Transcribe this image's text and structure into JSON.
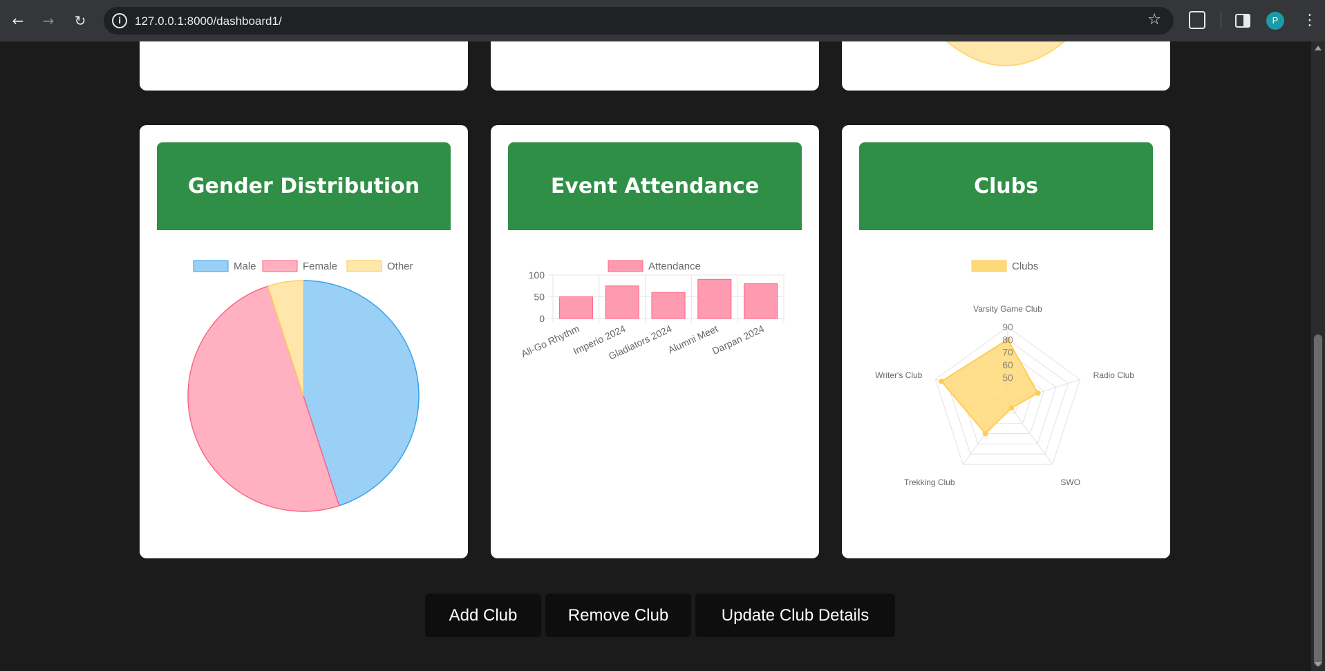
{
  "browser": {
    "url": "127.0.0.1:8000/dashboard1/",
    "avatar_letter": "P"
  },
  "cards": {
    "gender_title": "Gender Distribution",
    "attendance_title": "Event Attendance",
    "clubs_title": "Clubs"
  },
  "actions": {
    "add_label": "Add Club",
    "remove_label": "Remove Club",
    "update_label": "Update Club Details"
  },
  "colors": {
    "header_green": "#308f46",
    "male": "#9ad0f5",
    "female": "#ffb1c1",
    "other": "#ffe6aa",
    "attendance": "#ff9bb0",
    "clubs": "#ffd978"
  },
  "chart_data": [
    {
      "type": "pie",
      "legend": [
        "Male",
        "Female",
        "Other"
      ],
      "values": [
        45,
        50,
        5
      ],
      "legend_position": "top"
    },
    {
      "type": "bar",
      "series": [
        {
          "name": "Attendance",
          "values": [
            50,
            75,
            60,
            90,
            80
          ]
        }
      ],
      "categories": [
        "All-Go Rhythm",
        "Imperio 2024",
        "Gladiators 2024",
        "Alumni Meet",
        "Darpan 2024"
      ],
      "y_ticks": [
        0,
        50,
        100
      ],
      "ylim": [
        0,
        100
      ],
      "grid": true,
      "legend_position": "top"
    },
    {
      "type": "radar",
      "series": [
        {
          "name": "Clubs",
          "values": [
            80,
            55,
            35,
            60,
            85
          ]
        }
      ],
      "categories": [
        "Varsity Game Club",
        "Radio Club",
        "SWO",
        "Trekking Club",
        "Writer's Club"
      ],
      "r_ticks": [
        50,
        60,
        70,
        80,
        90
      ],
      "rlim": [
        30,
        90
      ],
      "legend_position": "top"
    }
  ]
}
